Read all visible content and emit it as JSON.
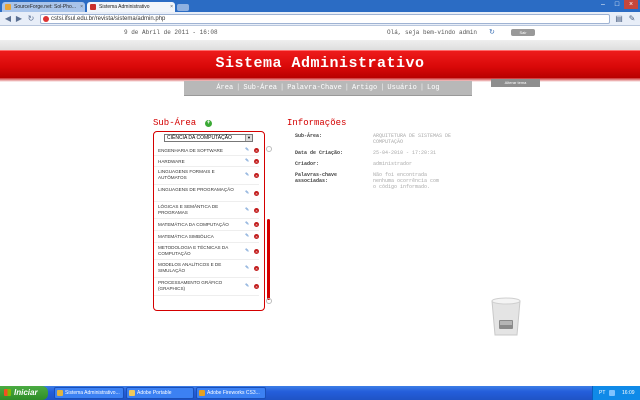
{
  "browser": {
    "tabs": [
      {
        "title": "SourceForge.net: Sol-Pho..."
      },
      {
        "title": "Sistema Administrativo"
      }
    ],
    "url": "cstsi.ifsul.edu.br/revista/sistema/admin.php"
  },
  "header": {
    "date": "9 de Abril de 2011 - 16:08",
    "welcome": "Olá, seja bem-vindo admin",
    "logout_label": "Sair",
    "site_title": "Sistema Administrativo",
    "theme_button": "Alterar tema"
  },
  "menu": [
    "Área",
    "Sub-Área",
    "Palavra-Chave",
    "Artigo",
    "Usuário",
    "Log"
  ],
  "subarea": {
    "title": "Sub-Área",
    "selected_area": "CIÊNCIA DA COMPUTAÇÃO",
    "items": [
      "ENGENHARIA DE SOFTWARE",
      "HARDWARE",
      "LINGUAGENS FORMAIS E AUTÔMATOS",
      "LINGUAGENS DE PROGRAMAÇÃO",
      "LÓGICAS E SEMÂNTICA DE PROGRAMAS",
      "MATEMÁTICA DA COMPUTAÇÃO",
      "MATEMÁTICA SIMBÓLICA",
      "METODOLOGIA E TÉCNICAS DA COMPUTAÇÃO",
      "MODELOS ANALÍTICOS E DE SIMULAÇÃO",
      "PROCESSAMENTO GRÁFICO (GRAPHICS)"
    ]
  },
  "info": {
    "title": "Informações",
    "fields": [
      {
        "label": "Sub-Área:",
        "value": "ARQUITETURA DE SISTEMAS DE COMPUTAÇÃO"
      },
      {
        "label": "Data de Criação:",
        "value": "25-04-2010 - 17:20:31"
      },
      {
        "label": "Criador:",
        "value": "administrador"
      },
      {
        "label": "Palavras-chave associadas:",
        "value": "Não foi encontrada nenhuma ocorrência com o código informado."
      }
    ]
  },
  "taskbar": {
    "start": "Iniciar",
    "items": [
      "Sistema Administrativo...",
      "Adobe Portable",
      "Adobe Fireworks CS3..."
    ],
    "lang": "PT",
    "clock": "16:09"
  },
  "colors": {
    "accent": "#d40000",
    "menu_gray": "#b8b8b8"
  }
}
